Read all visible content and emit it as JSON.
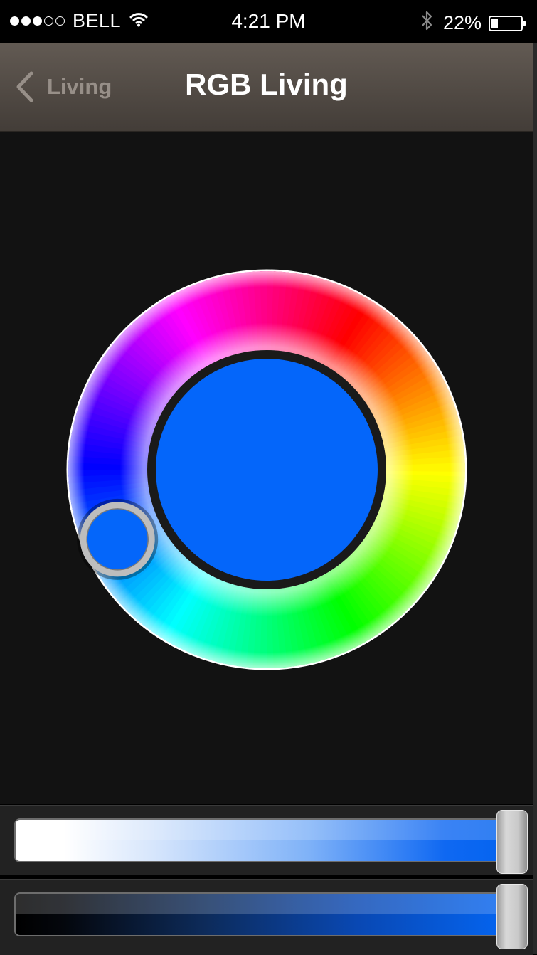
{
  "status_bar": {
    "carrier": "BELL",
    "signal_bars_filled": 3,
    "signal_bars_total": 5,
    "time": "4:21 PM",
    "battery_percent": "22%",
    "battery_level": 0.22,
    "icons": [
      "wifi-icon",
      "bluetooth-icon",
      "battery-icon"
    ]
  },
  "nav": {
    "back_label": "Living",
    "title": "RGB Living"
  },
  "color_wheel": {
    "selected_color": "#0466fa",
    "selected_hue_degrees": 215,
    "ring_colors": [
      "#ff0000",
      "#ffff00",
      "#00ff00",
      "#00ffff",
      "#0000ff",
      "#ff00ff"
    ]
  },
  "sliders": {
    "brightness": {
      "value": 1.0,
      "start_color": "#ffffff",
      "end_color": "#0464f0"
    },
    "saturation": {
      "value": 1.0,
      "start_color": "#000000",
      "end_color": "#0464f0"
    }
  },
  "colors": {
    "background": "#121212",
    "nav_bar": "#575049",
    "back_label": "#978f88"
  }
}
